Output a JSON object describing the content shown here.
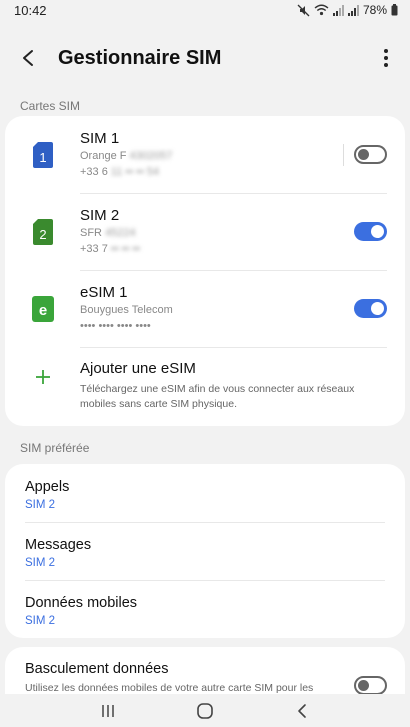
{
  "status_bar": {
    "time": "10:42",
    "battery": "78%",
    "icons": [
      "mute-icon",
      "wifi-icon",
      "signal-icon",
      "signal-icon",
      "battery-icon"
    ]
  },
  "header": {
    "title": "Gestionnaire SIM"
  },
  "sections": {
    "sim_cards_label": "Cartes SIM",
    "preferred_label": "SIM préférée"
  },
  "sims": [
    {
      "name": "SIM 1",
      "badge": "1",
      "operator": "Orange F",
      "operator_hidden": "4302057",
      "number_prefix": "+33 6",
      "number_hidden": "11 •• •• 54",
      "enabled": false,
      "icon_color": "#2f5fc4"
    },
    {
      "name": "SIM 2",
      "badge": "2",
      "operator": "SFR",
      "operator_hidden": "45224",
      "number_prefix": "+33 7",
      "number_hidden": "•• •• ••",
      "enabled": true,
      "icon_color": "#3a8a2e"
    },
    {
      "name": "eSIM 1",
      "badge": "e",
      "operator": "Bouygues Telecom",
      "number_prefix": "•••• •••• •••• ••••",
      "enabled": true,
      "icon_color": "#3aa53a"
    }
  ],
  "add_esim": {
    "title": "Ajouter une eSIM",
    "description": "Téléchargez une eSIM afin de vous connecter aux réseaux mobiles sans carte SIM physique."
  },
  "preferred": [
    {
      "title": "Appels",
      "value": "SIM 2"
    },
    {
      "title": "Messages",
      "value": "SIM 2"
    },
    {
      "title": "Données mobiles",
      "value": "SIM 2"
    }
  ],
  "data_switch": {
    "title": "Basculement données",
    "description": "Utilisez les données mobiles de votre autre carte SIM pour les appels ou lorsque les données mobiles ne sont pas disponibles.",
    "enabled": false
  },
  "colors": {
    "accent": "#3b6fe0",
    "background": "#f2f2f2"
  }
}
